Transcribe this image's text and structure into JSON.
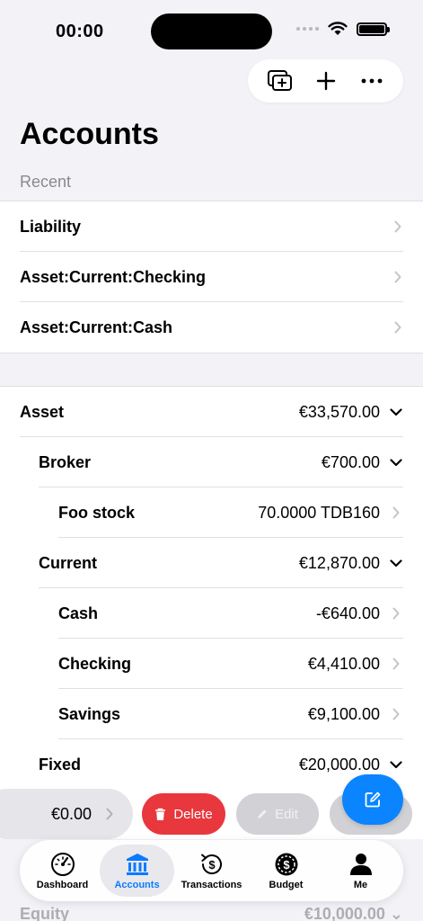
{
  "status": {
    "time": "00:00"
  },
  "title": "Accounts",
  "recent_header": "Recent",
  "recent": [
    {
      "label": "Liability"
    },
    {
      "label": "Asset:Current:Checking"
    },
    {
      "label": "Asset:Current:Cash"
    }
  ],
  "tree": [
    {
      "label": "Asset",
      "value": "€33,570.00",
      "level": 0,
      "expanded": true
    },
    {
      "label": "Broker",
      "value": "€700.00",
      "level": 1,
      "expanded": true
    },
    {
      "label": "Foo stock",
      "value": "70.0000 TDB160",
      "level": 2,
      "expanded": false
    },
    {
      "label": "Current",
      "value": "€12,870.00",
      "level": 1,
      "expanded": true
    },
    {
      "label": "Cash",
      "value": "-€640.00",
      "level": 2,
      "expanded": false
    },
    {
      "label": "Checking",
      "value": "€4,410.00",
      "level": 2,
      "expanded": false
    },
    {
      "label": "Savings",
      "value": "€9,100.00",
      "level": 2,
      "expanded": false
    },
    {
      "label": "Fixed",
      "value": "€20,000.00",
      "level": 1,
      "expanded": true
    }
  ],
  "swipe": {
    "value": "€0.00",
    "delete_label": "Delete",
    "edit_label": "Edit"
  },
  "tabs": [
    {
      "label": "Dashboard",
      "icon": "gauge-icon",
      "active": false
    },
    {
      "label": "Accounts",
      "icon": "bank-icon",
      "active": true
    },
    {
      "label": "Transactions",
      "icon": "dollar-cycle-icon",
      "active": false
    },
    {
      "label": "Budget",
      "icon": "budget-icon",
      "active": false
    },
    {
      "label": "Me",
      "icon": "person-icon",
      "active": false
    }
  ],
  "peek": {
    "label": "Equity",
    "value": "€10,000.00"
  },
  "colors": {
    "accent": "#0a84ff",
    "danger": "#e8373d"
  }
}
